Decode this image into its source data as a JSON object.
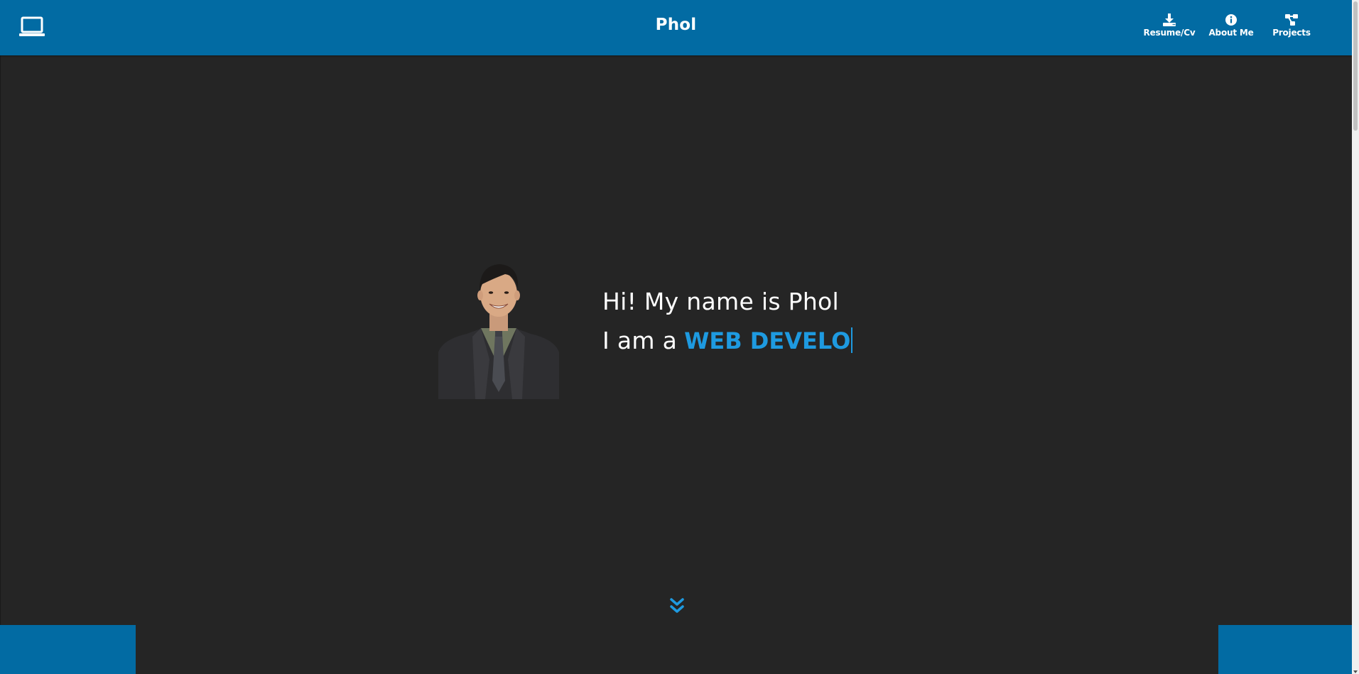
{
  "header": {
    "brand": "Phol",
    "logo_icon": "laptop-icon",
    "nav": [
      {
        "label": "Resume/Cv",
        "icon": "download-icon"
      },
      {
        "label": "About Me",
        "icon": "info-circle-icon"
      },
      {
        "label": "Projects",
        "icon": "project-diagram-icon"
      }
    ]
  },
  "hero": {
    "greeting": "Hi! My name is Phol",
    "role_prefix": "I am a",
    "role_typed": "WEB DEVELO"
  },
  "colors": {
    "navbar": "#026ba3",
    "background": "#252525",
    "accent": "#1e9ae0",
    "text": "#ffffff"
  }
}
